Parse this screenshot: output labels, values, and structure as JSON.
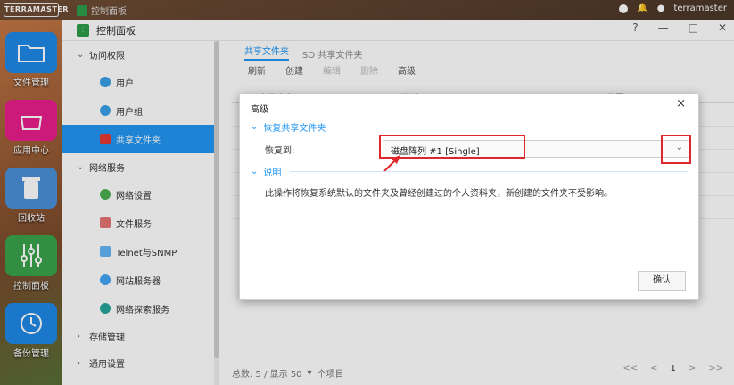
{
  "desktop": {
    "logo": "TERRAMASTER",
    "taskbar_app": "控制面板",
    "user": "terramaster",
    "icons": [
      {
        "label": "文件管理",
        "icon": "folder-icon",
        "color": "#1e88e5"
      },
      {
        "label": "应用中心",
        "icon": "shopping-bag-icon",
        "color": "#e91e8c"
      },
      {
        "label": "回收站",
        "icon": "recycle-bin-icon",
        "color": "#4a90d9"
      },
      {
        "label": "控制面板",
        "icon": "sliders-icon",
        "color": "#3aa24a"
      },
      {
        "label": "备份管理",
        "icon": "clock-icon",
        "color": "#1e88e5"
      }
    ]
  },
  "window": {
    "title": "控制面板",
    "controls": [
      "?",
      "—",
      "□",
      "✕"
    ]
  },
  "sidebar": {
    "groups": [
      {
        "label": "访问权限",
        "expanded": true
      },
      {
        "label": "网络服务",
        "expanded": true
      },
      {
        "label": "存储管理",
        "expanded": false
      },
      {
        "label": "通用设置",
        "expanded": false
      }
    ],
    "access_items": [
      "用户",
      "用户组",
      "共享文件夹"
    ],
    "network_items": [
      "网络设置",
      "文件服务",
      "Telnet与SNMP",
      "网站服务器",
      "网络探索服务"
    ],
    "active": "共享文件夹"
  },
  "main": {
    "tabs": [
      "共享文件夹",
      "ISO 共享文件夹"
    ],
    "toolbar": [
      "刷新",
      "创建",
      "编辑",
      "删除",
      "高级"
    ],
    "columns": [
      "文件夹名",
      "描述",
      "位置"
    ],
    "footer": "总数: 5 / 显示  50",
    "footer_suffix": "个项目",
    "pager": [
      "<<",
      "<",
      "1",
      ">",
      ">>"
    ]
  },
  "dialog": {
    "title": "高级",
    "section1": "恢复共享文件夹",
    "restore_label": "恢复到:",
    "restore_value": "磁盘阵列 #1 [Single]",
    "section2": "说明",
    "note": "此操作将恢复系统默认的文件夹及曾经创建过的个人资料夹，新创建的文件夹不受影响。",
    "ok": "确认"
  },
  "colors": {
    "accent": "#2196f3",
    "highlight": "#e0262b"
  }
}
